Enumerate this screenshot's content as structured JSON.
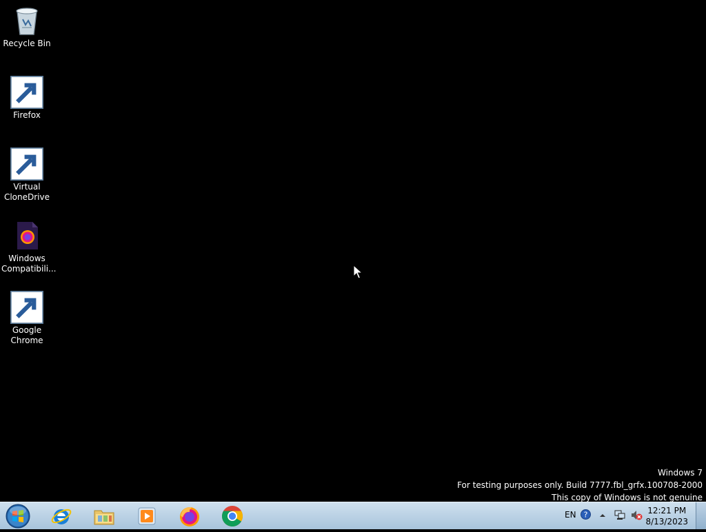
{
  "desktop": {
    "icons": [
      {
        "label": "Recycle Bin",
        "icon": "recycle-bin-icon"
      },
      {
        "label": "Firefox",
        "icon": "firefox-icon"
      },
      {
        "label": "Virtual CloneDrive",
        "icon": "virtual-clonedrive-icon"
      },
      {
        "label": "Windows Compatibili...",
        "icon": "firefox-document-icon"
      },
      {
        "label": "Google Chrome",
        "icon": "chrome-icon"
      }
    ]
  },
  "watermark": {
    "line1": "Windows 7",
    "line2": "For testing purposes only. Build 7777.fbl_grfx.100708-2000",
    "line3": "This copy of Windows is not genuine"
  },
  "taskbar": {
    "pinned": [
      {
        "icon": "internet-explorer-icon"
      },
      {
        "icon": "windows-explorer-icon"
      },
      {
        "icon": "media-player-icon"
      },
      {
        "icon": "firefox-icon"
      },
      {
        "icon": "chrome-icon"
      }
    ],
    "tray": {
      "language": "EN",
      "time": "12:21 PM",
      "date": "8/13/2023"
    }
  },
  "colors": {
    "desktop_background": "#000000",
    "taskbar_top": "#cfe0ee",
    "taskbar_bottom": "#a8c4dc"
  }
}
